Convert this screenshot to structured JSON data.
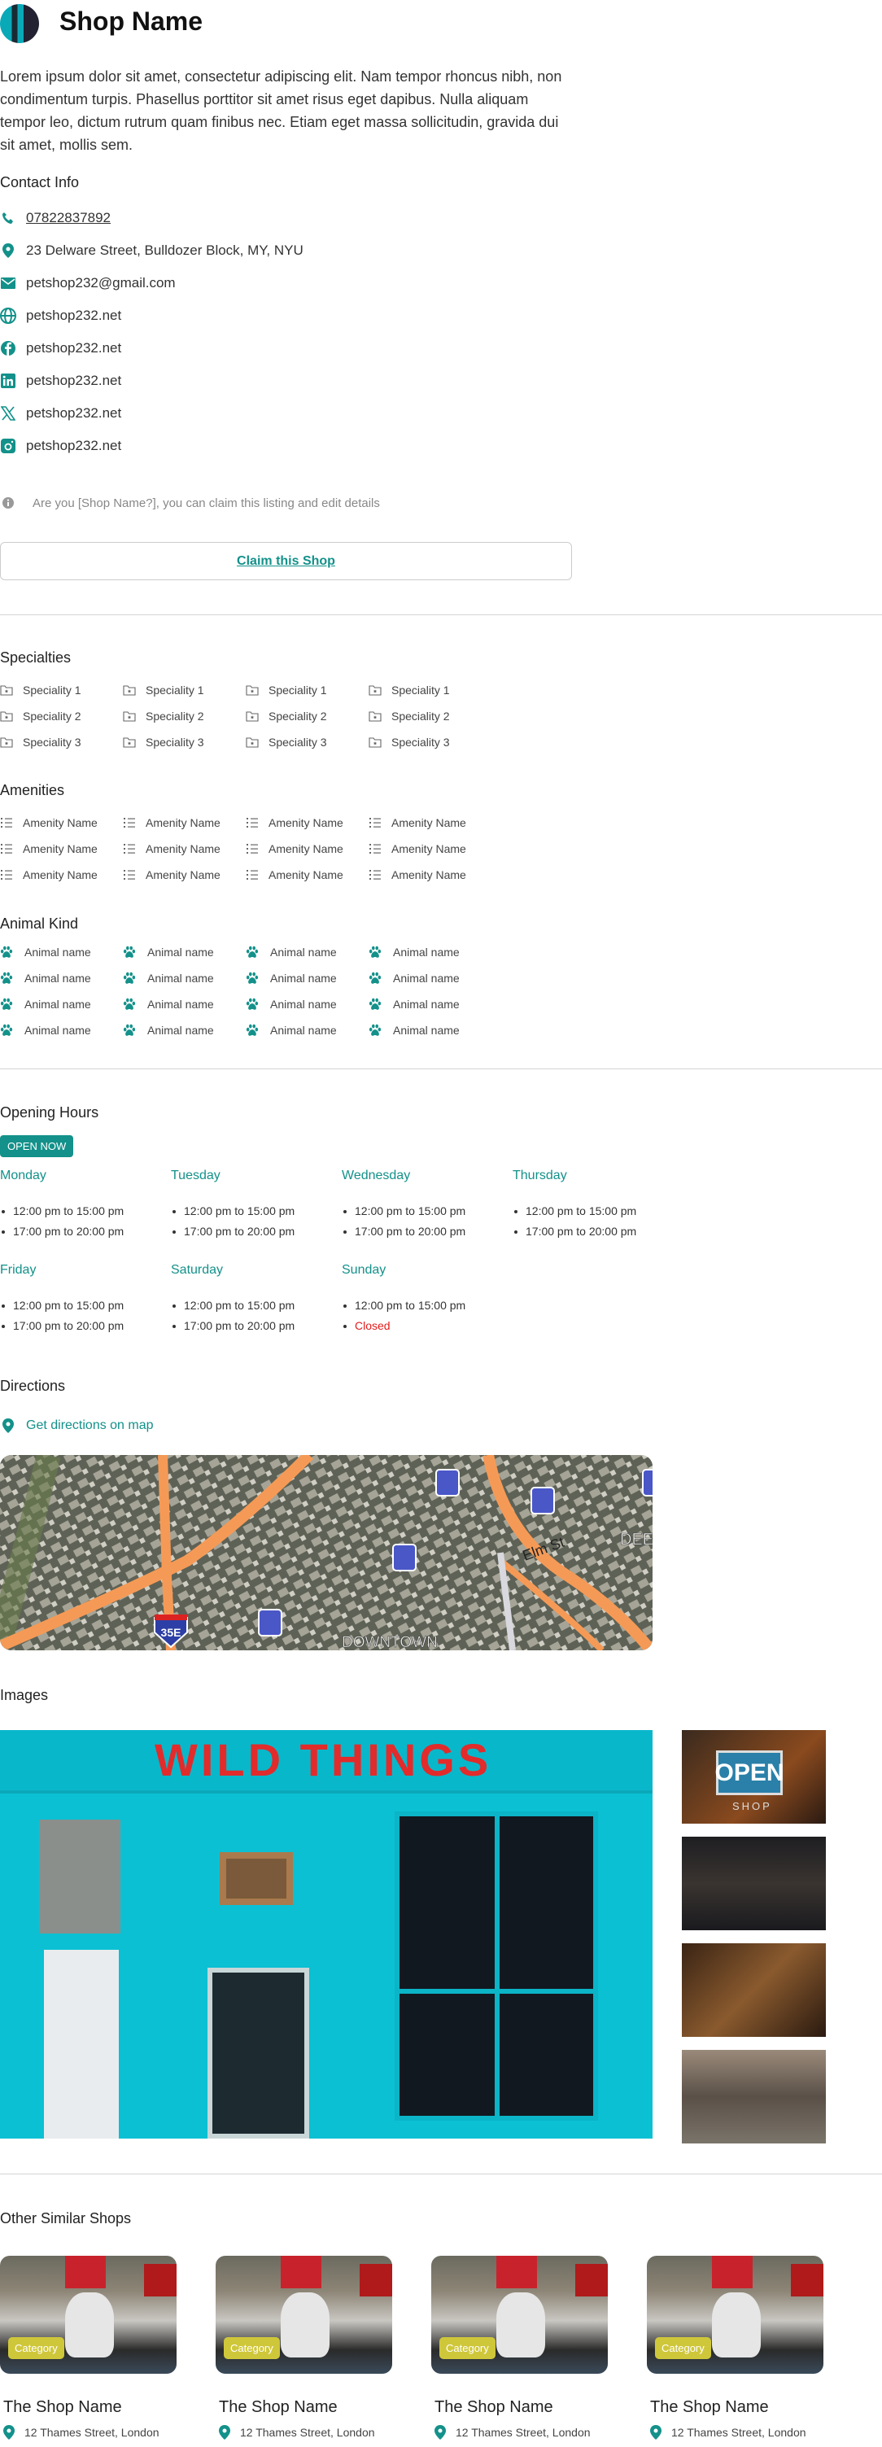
{
  "header": {
    "title": "Shop Name",
    "avatar_icon": "shop-avatar"
  },
  "description": "Lorem ipsum dolor sit amet, consectetur adipiscing elit. Nam tempor rhoncus nibh, non condimentum turpis. Phasellus porttitor sit amet risus eget dapibus. Nulla aliquam tempor leo, dictum rutrum quam finibus nec. Etiam eget massa sollicitudin, gravida dui sit amet, mollis sem.",
  "contact": {
    "heading": "Contact Info",
    "items": [
      {
        "icon": "phone-icon",
        "text": "07822837892"
      },
      {
        "icon": "location-pin-icon",
        "text": "23 Delware Street, Bulldozer Block, MY, NYU"
      },
      {
        "icon": "email-icon",
        "text": "petshop232@gmail.com"
      },
      {
        "icon": "globe-icon",
        "text": "petshop232.net"
      },
      {
        "icon": "facebook-icon",
        "text": "petshop232.net"
      },
      {
        "icon": "linkedin-icon",
        "text": "petshop232.net"
      },
      {
        "icon": "x-twitter-icon",
        "text": "petshop232.net"
      },
      {
        "icon": "instagram-icon",
        "text": "petshop232.net"
      }
    ]
  },
  "claim": {
    "note": "Are you [Shop Name?], you can claim this listing and edit details",
    "button": "Claim this Shop"
  },
  "specialties": {
    "heading": "Specialties",
    "rows": [
      "Speciality 1",
      "Speciality 2",
      "Speciality 3"
    ]
  },
  "amenities": {
    "heading": "Amenities",
    "rows": [
      "Amenity Name",
      "Amenity Name",
      "Amenity Name"
    ]
  },
  "animals": {
    "heading": "Animal Kind",
    "rows": [
      "Animal name",
      "Animal name",
      "Animal name",
      "Animal name"
    ]
  },
  "hours": {
    "heading": "Opening Hours",
    "badge": "OPEN NOW",
    "days": [
      {
        "name": "Monday",
        "slots": [
          "12:00 pm to 15:00 pm",
          "17:00 pm to 20:00 pm"
        ]
      },
      {
        "name": "Tuesday",
        "slots": [
          "12:00 pm to 15:00 pm",
          "17:00 pm to 20:00 pm"
        ]
      },
      {
        "name": "Wednesday",
        "slots": [
          "12:00 pm to 15:00 pm",
          "17:00 pm to 20:00 pm"
        ]
      },
      {
        "name": "Thursday",
        "slots": [
          "12:00 pm to 15:00 pm",
          "17:00 pm to 20:00 pm"
        ]
      },
      {
        "name": "Friday",
        "slots": [
          "12:00 pm to 15:00 pm",
          "17:00 pm to 20:00 pm"
        ]
      },
      {
        "name": "Saturday",
        "slots": [
          "12:00 pm to 15:00 pm",
          "17:00 pm to 20:00 pm"
        ]
      },
      {
        "name": "Sunday",
        "slots": [
          "12:00 pm to 15:00 pm",
          "Closed"
        ]
      }
    ]
  },
  "directions": {
    "heading": "Directions",
    "link": "Get directions on map",
    "map_labels": [
      "Elm St",
      "DOWNTOWN",
      "35E",
      "DEE"
    ]
  },
  "images": {
    "heading": "Images",
    "main_sign": "WILD THINGS",
    "thumb_sign": "OPEN",
    "thumb_sub": "SHOP"
  },
  "similar": {
    "heading": "Other Similar Shops",
    "cards": [
      {
        "category": "Category",
        "name": "The Shop Name",
        "address": "12 Thames Street, London"
      },
      {
        "category": "Category",
        "name": "The Shop Name",
        "address": "12 Thames Street, London"
      },
      {
        "category": "Category",
        "name": "The Shop Name",
        "address": "12 Thames Street, London"
      },
      {
        "category": "Category",
        "name": "The Shop Name",
        "address": "12 Thames Street, London"
      }
    ]
  },
  "colors": {
    "accent": "#13918a",
    "closed": "#e21b1b",
    "category_badge": "#cfc73a",
    "storefront": "#00c4d8"
  }
}
